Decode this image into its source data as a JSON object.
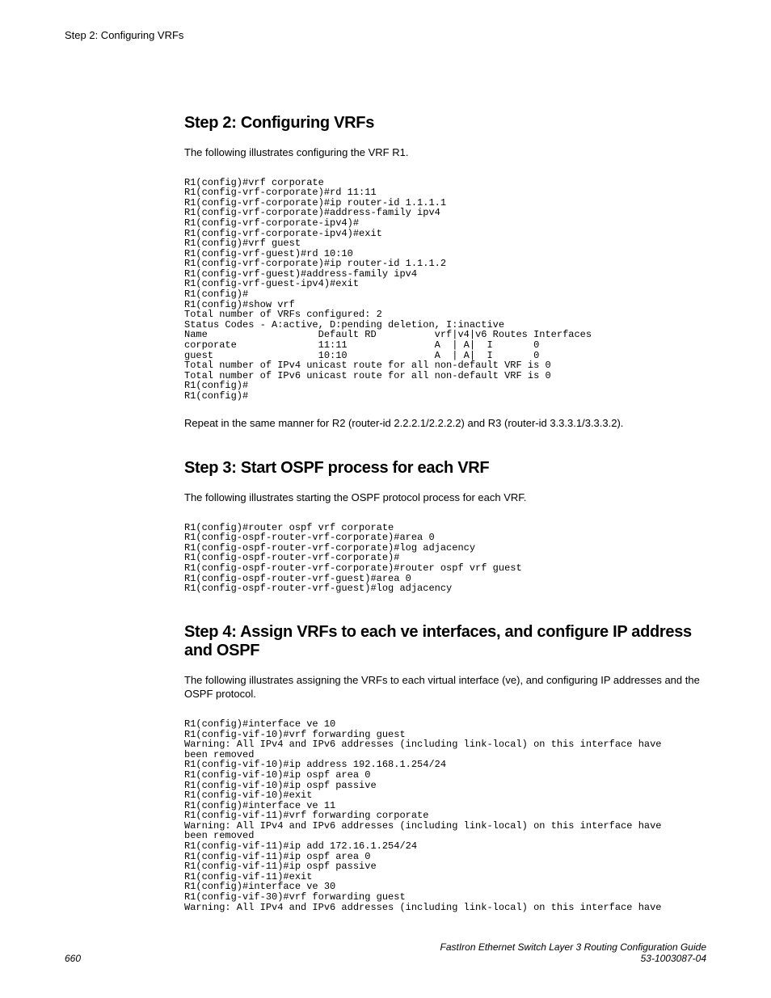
{
  "header": "Step 2: Configuring VRFs",
  "section1": {
    "heading": "Step 2: Configuring VRFs",
    "intro": "The following illustrates configuring the VRF R1.",
    "code": "R1(config)#vrf corporate\nR1(config-vrf-corporate)#rd 11:11\nR1(config-vrf-corporate)#ip router-id 1.1.1.1\nR1(config-vrf-corporate)#address-family ipv4\nR1(config-vrf-corporate-ipv4)#\nR1(config-vrf-corporate-ipv4)#exit\nR1(config)#vrf guest\nR1(config-vrf-guest)#rd 10:10\nR1(config-vrf-corporate)#ip router-id 1.1.1.2\nR1(config-vrf-guest)#address-family ipv4\nR1(config-vrf-guest-ipv4)#exit\nR1(config)#\nR1(config)#show vrf\nTotal number of VRFs configured: 2\nStatus Codes - A:active, D:pending deletion, I:inactive\nName                   Default RD          vrf|v4|v6 Routes Interfaces\ncorporate              11:11               A  | A|  I       0\nguest                  10:10               A  | A|  I       0\nTotal number of IPv4 unicast route for all non-default VRF is 0\nTotal number of IPv6 unicast route for all non-default VRF is 0\nR1(config)#\nR1(config)#",
    "after": "Repeat in the same manner for R2 (router-id 2.2.2.1/2.2.2.2) and R3 (router-id 3.3.3.1/3.3.3.2)."
  },
  "section2": {
    "heading": "Step 3: Start OSPF process for each VRF",
    "intro": "The following illustrates starting the OSPF protocol process for each VRF.",
    "code": "R1(config)#router ospf vrf corporate\nR1(config-ospf-router-vrf-corporate)#area 0\nR1(config-ospf-router-vrf-corporate)#log adjacency\nR1(config-ospf-router-vrf-corporate)#\nR1(config-ospf-router-vrf-corporate)#router ospf vrf guest\nR1(config-ospf-router-vrf-guest)#area 0\nR1(config-ospf-router-vrf-guest)#log adjacency"
  },
  "section3": {
    "heading": "Step 4: Assign VRFs to each ve interfaces, and configure IP address and OSPF",
    "intro": "The following illustrates assigning the VRFs to each virtual interface (ve), and configuring IP addresses and the OSPF protocol.",
    "code": "R1(config)#interface ve 10\nR1(config-vif-10)#vrf forwarding guest\nWarning: All IPv4 and IPv6 addresses (including link-local) on this interface have\nbeen removed\nR1(config-vif-10)#ip address 192.168.1.254/24\nR1(config-vif-10)#ip ospf area 0\nR1(config-vif-10)#ip ospf passive\nR1(config-vif-10)#exit\nR1(config)#interface ve 11\nR1(config-vif-11)#vrf forwarding corporate\nWarning: All IPv4 and IPv6 addresses (including link-local) on this interface have\nbeen removed\nR1(config-vif-11)#ip add 172.16.1.254/24\nR1(config-vif-11)#ip ospf area 0\nR1(config-vif-11)#ip ospf passive\nR1(config-vif-11)#exit\nR1(config)#interface ve 30\nR1(config-vif-30)#vrf forwarding guest\nWarning: All IPv4 and IPv6 addresses (including link-local) on this interface have"
  },
  "footer": {
    "page": "660",
    "title": "FastIron Ethernet Switch Layer 3 Routing Configuration Guide",
    "docnum": "53-1003087-04"
  }
}
